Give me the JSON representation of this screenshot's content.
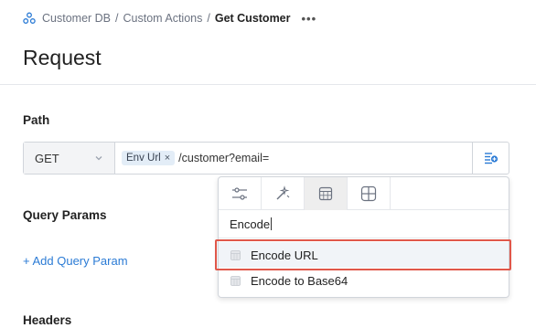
{
  "breadcrumb": {
    "items": [
      "Customer DB",
      "Custom Actions"
    ],
    "separator": "/",
    "current": "Get Customer",
    "more": "•••"
  },
  "page": {
    "title": "Request"
  },
  "path_section": {
    "label": "Path",
    "method": "GET",
    "env_chip": {
      "label": "Env Url",
      "remove": "×"
    },
    "path_text": "/customer?email="
  },
  "query_params": {
    "label": "Query Params",
    "add_link": "+ Add Query Param"
  },
  "headers": {
    "label": "Headers"
  },
  "popover": {
    "tabs": [
      {
        "icon": "sliders-icon",
        "active": false
      },
      {
        "icon": "magic-wand-icon",
        "active": false
      },
      {
        "icon": "calculator-icon",
        "active": true
      },
      {
        "icon": "grid-icon",
        "active": false
      }
    ],
    "search_value": "Encode",
    "items": [
      {
        "label": "Encode URL",
        "icon": "function-icon",
        "selected": true
      },
      {
        "label": "Encode to Base64",
        "icon": "function-icon",
        "selected": false
      }
    ]
  },
  "colors": {
    "link": "#2b7bd5",
    "highlight": "#e0574a",
    "chip_bg": "#e3edf7",
    "accent_icon": "#2b7bd5"
  }
}
